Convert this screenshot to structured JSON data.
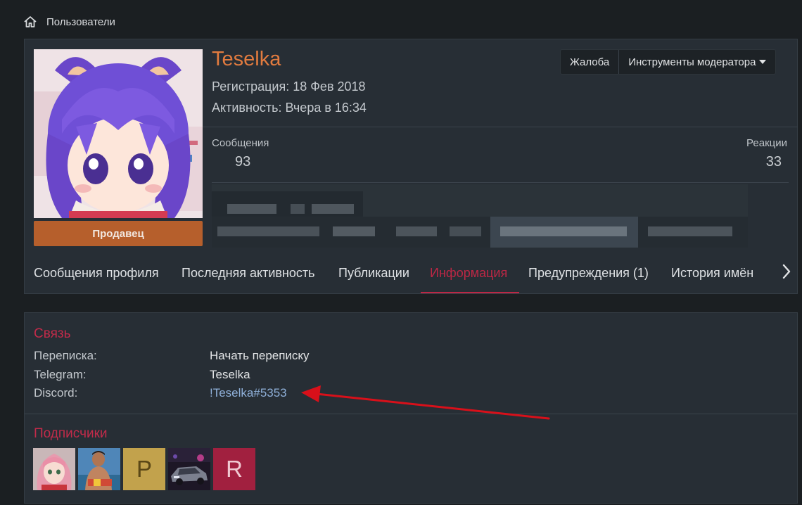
{
  "breadcrumb": {
    "label": "Пользователи"
  },
  "profile": {
    "username": "Teselka",
    "registration": "Регистрация: 18 Фев 2018",
    "activity": "Активность: Вчера в 16:34",
    "badge": "Продавец",
    "report_button": "Жалоба",
    "moderator_tools": "Инструменты модератора",
    "stats": {
      "messages_label": "Сообщения",
      "messages_value": "93",
      "reactions_label": "Реакции",
      "reactions_value": "33"
    }
  },
  "tabs": [
    {
      "label": "Сообщения профиля"
    },
    {
      "label": "Последняя активность"
    },
    {
      "label": "Публикации"
    },
    {
      "label": "Информация",
      "active": true
    },
    {
      "label": "Предупреждения (1)"
    },
    {
      "label": "История имён"
    }
  ],
  "info": {
    "contact_title": "Связь",
    "rows": [
      {
        "key": "Переписка:",
        "value": "Начать переписку"
      },
      {
        "key": "Telegram:",
        "value": "Teselka"
      },
      {
        "key": "Discord:",
        "value": "!Teselka#5353"
      }
    ],
    "followers_title": "Подписчики",
    "followers": [
      {
        "kind": "image",
        "icon": "pink-hair-avatar"
      },
      {
        "kind": "image",
        "icon": "man-photo-avatar"
      },
      {
        "kind": "letter",
        "letter": "P",
        "bg": "#c2a24c",
        "fg": "#5a4716"
      },
      {
        "kind": "image",
        "icon": "car-photo-avatar"
      },
      {
        "kind": "letter",
        "letter": "R",
        "bg": "#a1203f",
        "fg": "#f0c9d2"
      }
    ]
  },
  "colors": {
    "accent": "#bd2745",
    "username": "#e27b3f",
    "seller": "#b65f2c",
    "link": "#8fb0d9",
    "annotation_arrow": "#d8101a"
  }
}
